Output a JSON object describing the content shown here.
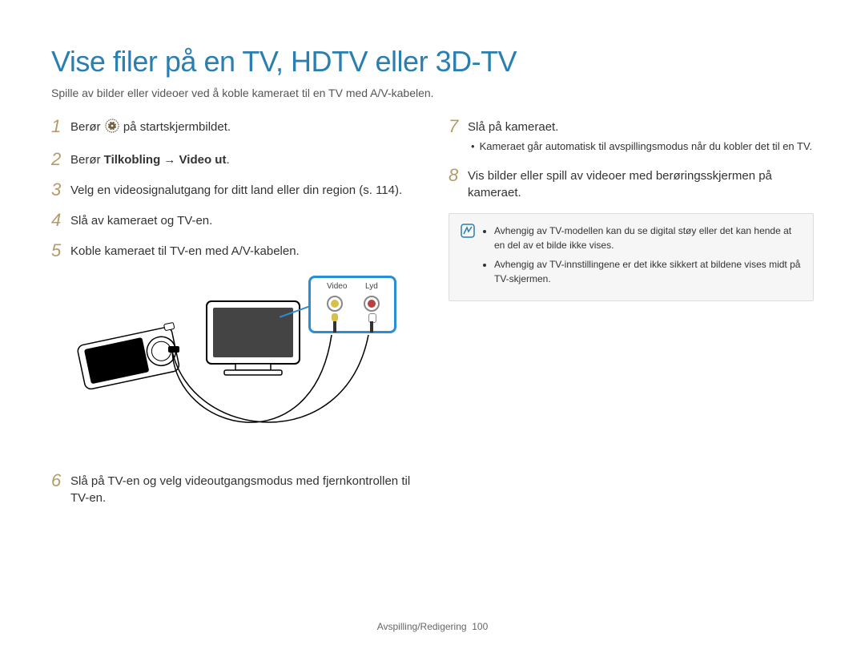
{
  "title": "Vise filer på en TV, HDTV eller 3D-TV",
  "subtitle": "Spille av bilder eller videoer ved å koble kameraet til en TV med A/V-kabelen.",
  "steps": {
    "s1": {
      "num": "1",
      "pre": "Berør ",
      "post": " på startskjermbildet."
    },
    "s2": {
      "num": "2",
      "pre": "Berør ",
      "bold": "Tilkobling → Video ut",
      "post": "."
    },
    "s3": {
      "num": "3",
      "text": "Velg en videosignalutgang for ditt land eller din region (s. 114)."
    },
    "s4": {
      "num": "4",
      "text": "Slå av kameraet og TV-en."
    },
    "s5": {
      "num": "5",
      "text": "Koble kameraet til TV-en med A/V-kabelen."
    },
    "s6": {
      "num": "6",
      "text": "Slå på TV-en og velg videoutgangsmodus med fjernkontrollen til TV-en."
    },
    "s7": {
      "num": "7",
      "text": "Slå på kameraet.",
      "sub": "Kameraet går automatisk til avspillingsmodus når du kobler det til en TV."
    },
    "s8": {
      "num": "8",
      "text": "Vis bilder eller spill av videoer med berøringsskjermen på kameraet."
    }
  },
  "diagram": {
    "video_label": "Video",
    "audio_label": "Lyd"
  },
  "notes": {
    "n1": "Avhengig av TV-modellen kan du se digital støy eller det kan hende at en del av et bilde ikke vises.",
    "n2": "Avhengig av TV-innstillingene er det ikke sikkert at bildene vises midt på TV-skjermen."
  },
  "footer": {
    "section": "Avspilling/Redigering",
    "page": "100"
  }
}
